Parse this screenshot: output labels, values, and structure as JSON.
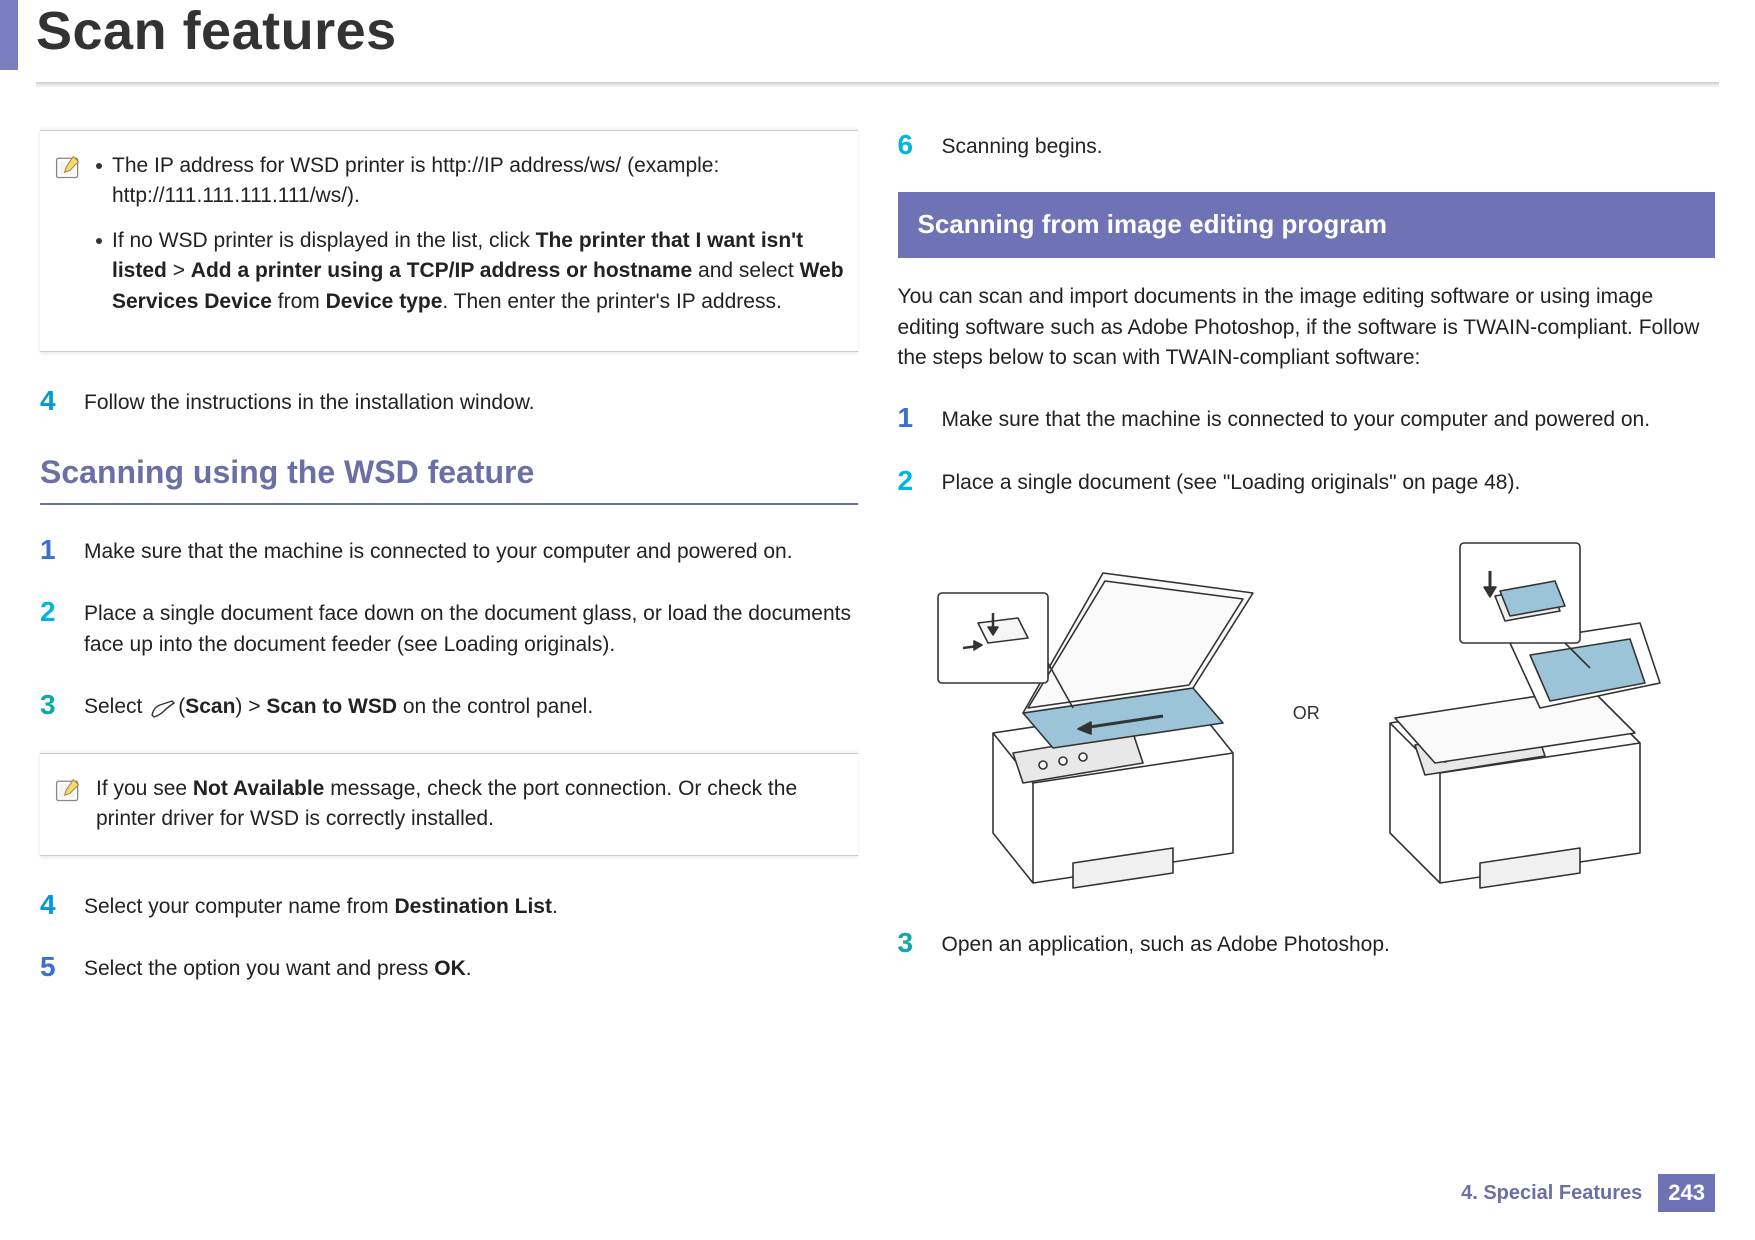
{
  "header": {
    "title": "Scan features"
  },
  "left": {
    "note1": {
      "bullets": [
        {
          "pre": "The IP address for WSD printer is http://IP address/ws/ (example: http://111.111.111.111/ws/)."
        },
        {
          "pre": "If no WSD printer is displayed in the list, click ",
          "b1": "The printer that I want isn't listed",
          "mid1": " > ",
          "b2": "Add a printer using a TCP/IP address or hostname",
          "mid2": " and select ",
          "b3": "Web Services Device",
          "mid3": " from ",
          "b4": "Device type",
          "post": ". Then enter the printer's IP address."
        }
      ]
    },
    "step4a": {
      "num": "4",
      "text": "Follow the instructions in the installation window."
    },
    "h2": "Scanning using the WSD feature",
    "steps": {
      "s1": {
        "num": "1",
        "text": "Make sure that the machine is connected to your computer and powered on."
      },
      "s2": {
        "num": "2",
        "text": "Place a single document face down on the document glass, or load the documents face up into the document feeder (see Loading originals)."
      },
      "s3": {
        "num": "3",
        "pre": "Select ",
        "scan": "Scan",
        "mid": ") > ",
        "b1": "Scan to WSD",
        "post": " on the control panel."
      }
    },
    "note2": {
      "pre": "If you see ",
      "b1": "Not Available",
      "post": " message, check the port connection. Or check the printer driver for WSD is correctly installed."
    },
    "s4": {
      "num": "4",
      "pre": "Select your computer name from ",
      "b1": "Destination List",
      "post": "."
    },
    "s5": {
      "num": "5",
      "pre": "Select the option you want and press ",
      "b1": "OK",
      "post": "."
    }
  },
  "right": {
    "s6": {
      "num": "6",
      "text": "Scanning begins."
    },
    "band": "Scanning from image editing program",
    "intro": "You can scan and import documents in the image editing software or using image editing software such as Adobe Photoshop, if the software is TWAIN-compliant. Follow the steps below to scan with TWAIN-compliant software:",
    "s1": {
      "num": "1",
      "text": "Make sure that the machine is connected to your computer and powered on."
    },
    "s2": {
      "num": "2",
      "text": "Place a single document (see \"Loading originals\" on page 48)."
    },
    "or": "OR",
    "s3": {
      "num": "3",
      "text": "Open an application, such as Adobe Photoshop."
    }
  },
  "footer": {
    "chapter": "4.  Special Features",
    "page": "243"
  }
}
